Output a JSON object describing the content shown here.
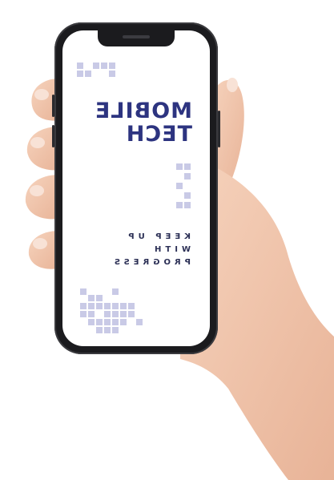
{
  "screen": {
    "title_line1": "MOBILE",
    "title_line2": "TECH",
    "tagline_line1": "KEEP UP",
    "tagline_line2": "WITH",
    "tagline_line3": "PROGRESS"
  },
  "colors": {
    "title": "#2d3480",
    "tagline": "#2b2f55",
    "pixel_accent": "#c9cae6",
    "phone_frame": "#1b1b1e",
    "skin": "#f1c7ae"
  },
  "image_notes": {
    "mirrored_text": true
  }
}
